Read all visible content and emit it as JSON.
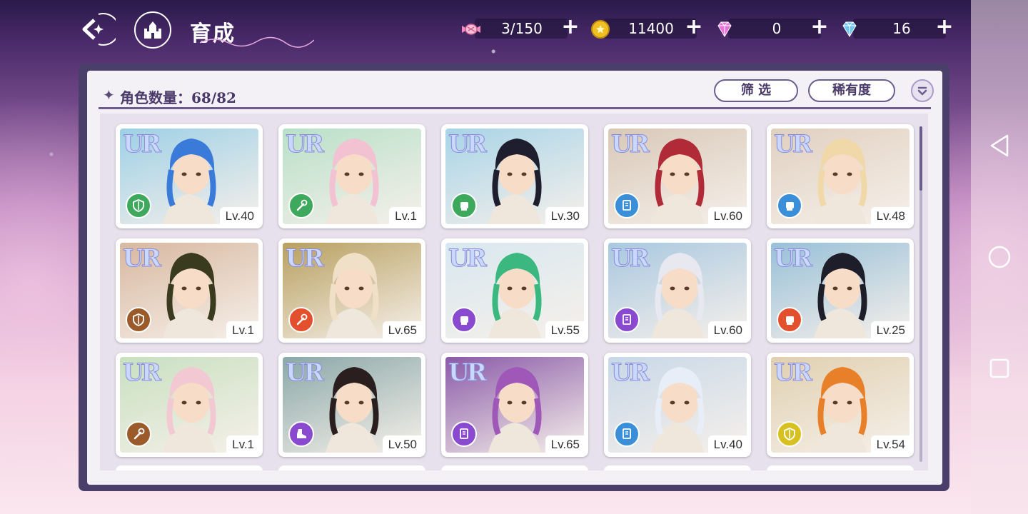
{
  "header": {
    "title": "育成",
    "back_icon": "back-arrow-icon",
    "home_icon": "castle-icon"
  },
  "resources": [
    {
      "name": "candy",
      "icon": "candy-icon",
      "value": "3/150"
    },
    {
      "name": "gold",
      "icon": "gold-coin-icon",
      "value": "11400"
    },
    {
      "name": "pink-gem",
      "icon": "pink-diamond-icon",
      "value": "0"
    },
    {
      "name": "blue-gem",
      "icon": "blue-diamond-icon",
      "value": "16"
    }
  ],
  "panel": {
    "count_label": "角色数量：68/82",
    "filter_label": "筛 选",
    "rarity_label": "稀有度",
    "sort_icon": "sort-toggle-icon"
  },
  "colors": {
    "attr_green": "#3ea85c",
    "attr_blue": "#3a8fd8",
    "attr_purple": "#8a4ad0",
    "attr_red": "#e2502e",
    "attr_brown": "#9a5a2a",
    "attr_yellow": "#d8c020"
  },
  "cards": [
    {
      "rarity": "UR",
      "level": "Lv.40",
      "attr": "green",
      "attr_icon": "shield-icon",
      "hair": "#3a7ad8",
      "bg": "#9ed0e6"
    },
    {
      "rarity": "UR",
      "level": "Lv.1",
      "attr": "green",
      "attr_icon": "wand-icon",
      "hair": "#f2c2d2",
      "bg": "#b8e0c8"
    },
    {
      "rarity": "UR",
      "level": "Lv.30",
      "attr": "green",
      "attr_icon": "fist-icon",
      "hair": "#1e1e2e",
      "bg": "#a8d4e8"
    },
    {
      "rarity": "UR",
      "level": "Lv.60",
      "attr": "blue",
      "attr_icon": "book-icon",
      "hair": "#b02a38",
      "bg": "#d8c8b8"
    },
    {
      "rarity": "UR",
      "level": "Lv.48",
      "attr": "blue",
      "attr_icon": "fist-icon",
      "hair": "#f0d8a8",
      "bg": "#e0d0c0"
    },
    {
      "rarity": "UR",
      "level": "Lv.1",
      "attr": "brown",
      "attr_icon": "shield-icon",
      "hair": "#3a3a1e",
      "bg": "#d8b8a0"
    },
    {
      "rarity": "UR",
      "level": "Lv.65",
      "attr": "red",
      "attr_icon": "wand-icon",
      "hair": "#f0e0c8",
      "bg": "#b8a060"
    },
    {
      "rarity": "UR",
      "level": "Lv.55",
      "attr": "purple",
      "attr_icon": "fist-icon",
      "hair": "#3ab880",
      "bg": "#d8e8f0"
    },
    {
      "rarity": "UR",
      "level": "Lv.60",
      "attr": "purple",
      "attr_icon": "book-icon",
      "hair": "#e8e8f0",
      "bg": "#a8c8e0"
    },
    {
      "rarity": "UR",
      "level": "Lv.25",
      "attr": "red",
      "attr_icon": "fist-icon",
      "hair": "#1e1e2a",
      "bg": "#98c0d8"
    },
    {
      "rarity": "UR",
      "level": "Lv.1",
      "attr": "brown",
      "attr_icon": "wand-icon",
      "hair": "#f2c8d2",
      "bg": "#c8e0c0"
    },
    {
      "rarity": "UR",
      "level": "Lv.50",
      "attr": "purple",
      "attr_icon": "shoe-icon",
      "hair": "#2a1e1e",
      "bg": "#8aa8a8"
    },
    {
      "rarity": "UR",
      "level": "Lv.65",
      "attr": "purple",
      "attr_icon": "book-icon",
      "hair": "#a058b8",
      "bg": "#8a5aa8"
    },
    {
      "rarity": "UR",
      "level": "Lv.40",
      "attr": "blue",
      "attr_icon": "book-icon",
      "hair": "#e8eef8",
      "bg": "#c8d8e8"
    },
    {
      "rarity": "UR",
      "level": "Lv.54",
      "attr": "yellow",
      "attr_icon": "shield-icon",
      "hair": "#e8802a",
      "bg": "#e0d0b0"
    }
  ],
  "android_nav": [
    {
      "icon": "back-triangle-icon"
    },
    {
      "icon": "home-circle-icon"
    },
    {
      "icon": "recents-square-icon"
    }
  ]
}
